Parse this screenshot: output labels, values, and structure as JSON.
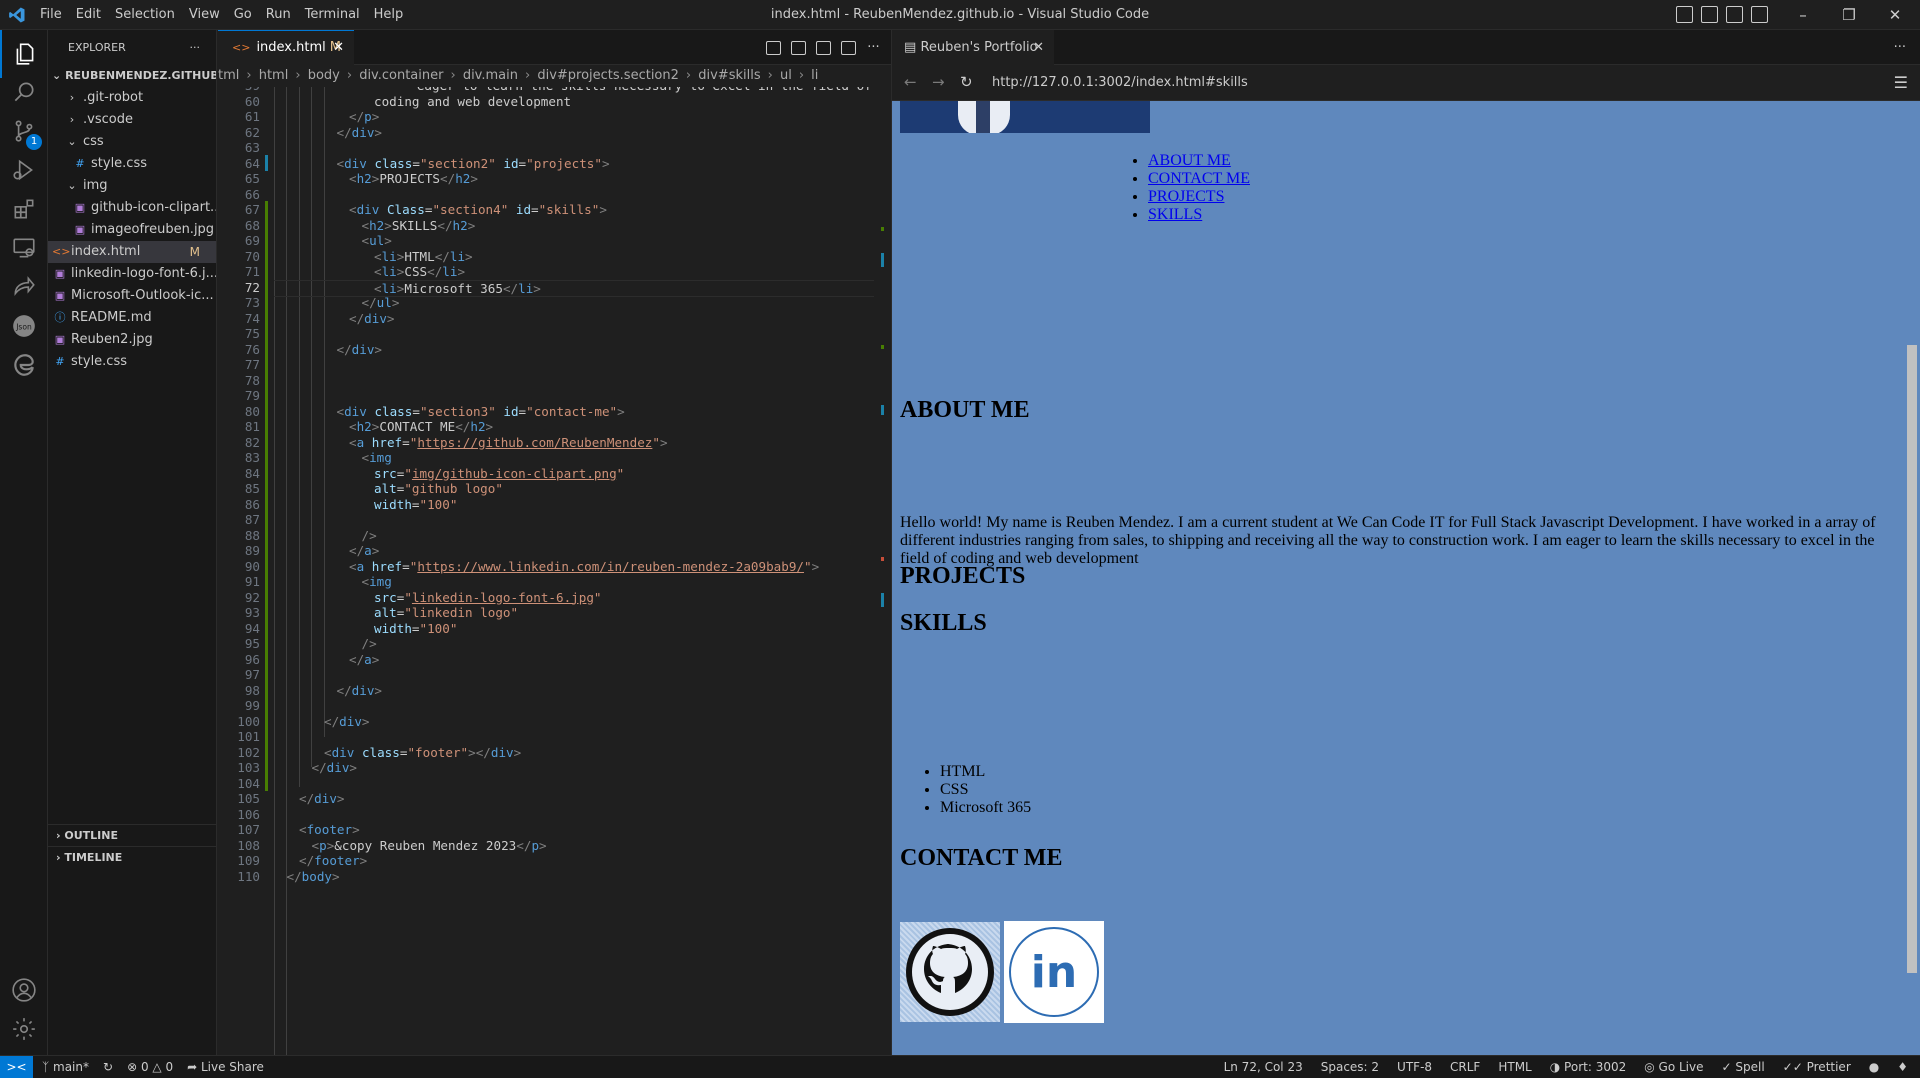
{
  "titlebar": {
    "menu": [
      "File",
      "Edit",
      "Selection",
      "View",
      "Go",
      "Run",
      "Terminal",
      "Help"
    ],
    "title": "index.html - ReubenMendez.github.io - Visual Studio Code"
  },
  "activitybar": {
    "items": [
      "explorer-icon",
      "search-icon",
      "source-control-icon",
      "run-debug-icon",
      "extensions-icon",
      "remote-explorer-icon",
      "live-share-icon",
      "json-icon",
      "edge-devtools-icon"
    ],
    "scm_badge": "1",
    "bottom": [
      "account-icon",
      "settings-gear-icon"
    ]
  },
  "explorer": {
    "header": "EXPLORER",
    "dots": "···",
    "root": "REUBENMENDEZ.GITHUB.IO",
    "items": [
      {
        "label": ".git-robot",
        "kind": "folder"
      },
      {
        "label": ".vscode",
        "kind": "folder"
      },
      {
        "label": "css",
        "kind": "folder-open"
      },
      {
        "label": "style.css",
        "kind": "css"
      },
      {
        "label": "img",
        "kind": "folder-open"
      },
      {
        "label": "github-icon-clipart....",
        "kind": "image"
      },
      {
        "label": "imageofreuben.jpg",
        "kind": "image"
      },
      {
        "label": "index.html",
        "kind": "html",
        "status": "M"
      },
      {
        "label": "linkedin-logo-font-6.j...",
        "kind": "image"
      },
      {
        "label": "Microsoft-Outlook-ic...",
        "kind": "image"
      },
      {
        "label": "README.md",
        "kind": "info"
      },
      {
        "label": "Reuben2.jpg",
        "kind": "image"
      },
      {
        "label": "style.css",
        "kind": "css"
      }
    ],
    "outline": "OUTLINE",
    "timeline": "TIMELINE"
  },
  "editor": {
    "tab_label": "index.html",
    "tab_status": "M",
    "breadcrumbs": [
      "tml",
      "html",
      "body",
      "div.container",
      "div.main",
      "div#projects.section2",
      "div#skills",
      "ul",
      "li"
    ],
    "line_numbers": [
      "59",
      "60",
      "61",
      "62",
      "63",
      "64",
      "65",
      "66",
      "67",
      "68",
      "69",
      "70",
      "71",
      "72",
      "73",
      "74",
      "75",
      "76",
      "77",
      "78",
      "79",
      "80",
      "81",
      "82",
      "83",
      "84",
      "85",
      "86",
      "87",
      "88",
      "89",
      "90",
      "91",
      "92",
      "93",
      "94",
      "95",
      "96",
      "97",
      "98",
      "99",
      "100",
      "101",
      "102",
      "103",
      "104",
      "105",
      "106",
      "107",
      "108",
      "109",
      "110"
    ],
    "current_line": "72"
  },
  "preview": {
    "tab_label": "Reuben's Portfolio",
    "url": "http://127.0.0.1:3002/index.html#skills",
    "nav_links": [
      "ABOUT ME",
      "CONTACT ME",
      "PROJECTS",
      "SKILLS"
    ],
    "about_heading": "ABOUT ME",
    "about_text": "Hello world! My name is Reuben Mendez. I am a current student at We Can Code IT for Full Stack Javascript Development. I have worked in a array of different industries ranging from sales, to shipping and receiving all the way to construction work. I am eager to learn the skills necessary to excel in the field of coding and web development",
    "projects_heading": "PROJECTS",
    "skills_heading": "SKILLS",
    "skills": [
      "HTML",
      "CSS",
      "Microsoft 365"
    ],
    "contact_heading": "CONTACT ME",
    "linkedin_text": "in"
  },
  "statusbar": {
    "branch": "main*",
    "errors": "0",
    "warnings": "0",
    "live_share": "Live Share",
    "position": "Ln 72, Col 23",
    "spaces": "Spaces: 2",
    "encoding": "UTF-8",
    "eol": "CRLF",
    "language": "HTML",
    "port": "Port: 3002",
    "go_live": "Go Live",
    "spell": "Spell",
    "prettier": "Prettier"
  },
  "colors": {
    "accent": "#0078d4",
    "page_bg": "#5f88bd",
    "modified": "#e2c08d"
  }
}
